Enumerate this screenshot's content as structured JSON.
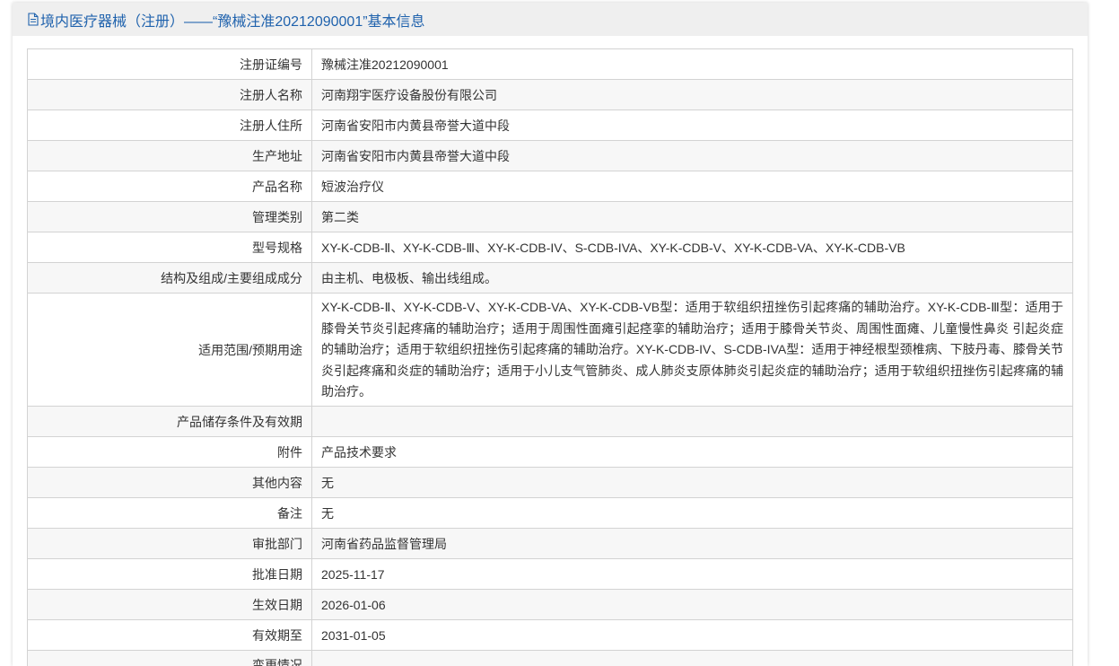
{
  "theme": {
    "accent": "#1f62ad",
    "border": "#d3d3d3",
    "stripe": "#f7f7f7",
    "header_bg": "#efefef"
  },
  "header": {
    "icon": "document-icon",
    "title": "境内医疗器械（注册）——“豫械注准20212090001”基本信息"
  },
  "rows": [
    {
      "label": "注册证编号",
      "value": "豫械注准20212090001"
    },
    {
      "label": "注册人名称",
      "value": "河南翔宇医疗设备股份有限公司"
    },
    {
      "label": "注册人住所",
      "value": "河南省安阳市内黄县帝誉大道中段"
    },
    {
      "label": "生产地址",
      "value": "河南省安阳市内黄县帝誉大道中段"
    },
    {
      "label": "产品名称",
      "value": "短波治疗仪"
    },
    {
      "label": "管理类别",
      "value": "第二类"
    },
    {
      "label": "型号规格",
      "value": "XY-K-CDB-Ⅱ、XY-K-CDB-Ⅲ、XY-K-CDB-IV、S-CDB-IVA、XY-K-CDB-V、XY-K-CDB-VA、XY-K-CDB-VB"
    },
    {
      "label": "结构及组成/主要组成成分",
      "value": "由主机、电极板、输出线组成。"
    },
    {
      "label": "适用范围/预期用途",
      "value": "XY-K-CDB-Ⅱ、XY-K-CDB-V、XY-K-CDB-VA、XY-K-CDB-VB型：适用于软组织扭挫伤引起疼痛的辅助治疗。XY-K-CDB-Ⅲ型：适用于膝骨关节炎引起疼痛的辅助治疗；适用于周围性面瘫引起痉挛的辅助治疗；适用于膝骨关节炎、周围性面瘫、儿童慢性鼻炎 引起炎症的辅助治疗；适用于软组织扭挫伤引起疼痛的辅助治疗。XY-K-CDB-IV、S-CDB-IVA型：适用于神经根型颈椎病、下肢丹毒、膝骨关节炎引起疼痛和炎症的辅助治疗；适用于小儿支气管肺炎、成人肺炎支原体肺炎引起炎症的辅助治疗；适用于软组织扭挫伤引起疼痛的辅助治疗。"
    },
    {
      "label": "产品储存条件及有效期"
    },
    {
      "label": "附件",
      "value": "产品技术要求"
    },
    {
      "label": "其他内容",
      "value": "无"
    },
    {
      "label": "备注",
      "value": "无"
    },
    {
      "label": "审批部门",
      "value": "河南省药品监督管理局"
    },
    {
      "label": "批准日期",
      "value": "2025-11-17"
    },
    {
      "label": "生效日期",
      "value": "2026-01-06"
    },
    {
      "label": "有效期至",
      "value": "2031-01-05"
    },
    {
      "label": "变更情况"
    }
  ]
}
